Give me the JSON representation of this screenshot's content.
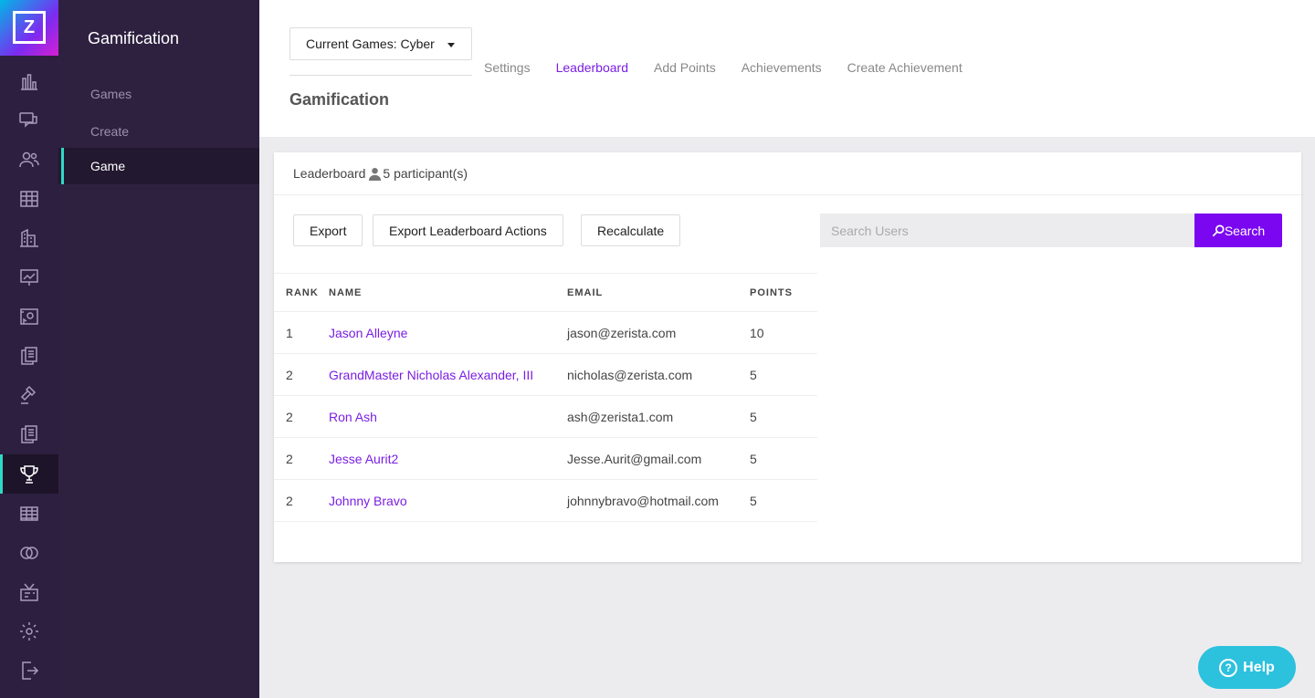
{
  "logo": {
    "letter": "Z"
  },
  "rail": {
    "icons": [
      "chart-icon",
      "chat-icon",
      "users-icon",
      "grid-icon",
      "buildings-icon",
      "presentation-icon",
      "gallery-icon",
      "documents-icon",
      "gavel-icon",
      "documents-2-icon",
      "trophy-icon",
      "table-icon",
      "rings-icon",
      "broadcast-icon",
      "gear-icon",
      "exit-icon"
    ],
    "active": "trophy-icon"
  },
  "sidebar": {
    "title": "Gamification",
    "items": [
      {
        "label": "Games"
      },
      {
        "label": "Create"
      },
      {
        "label": "Game",
        "active": true
      }
    ]
  },
  "header": {
    "game_select": "Current Games: Cyber",
    "tabs": [
      {
        "label": "Settings"
      },
      {
        "label": "Leaderboard",
        "active": true
      },
      {
        "label": "Add Points"
      },
      {
        "label": "Achievements"
      },
      {
        "label": "Create Achievement"
      }
    ],
    "page_title": "Gamification"
  },
  "leaderboard": {
    "title": "Leaderboard",
    "participants": "5 participant(s)",
    "buttons": {
      "export": "Export",
      "export_actions": "Export Leaderboard Actions",
      "recalculate": "Recalculate"
    },
    "search": {
      "placeholder": "Search Users",
      "button": "Search"
    },
    "columns": [
      "RANK",
      "NAME",
      "EMAIL",
      "POINTS"
    ],
    "rows": [
      {
        "rank": "1",
        "name": "Jason Alleyne",
        "email": "jason@zerista.com",
        "points": "10"
      },
      {
        "rank": "2",
        "name": "GrandMaster Nicholas Alexander, III",
        "email": "nicholas@zerista.com",
        "points": "5"
      },
      {
        "rank": "2",
        "name": "Ron Ash",
        "email": "ash@zerista1.com",
        "points": "5"
      },
      {
        "rank": "2",
        "name": "Jesse Aurit2",
        "email": "Jesse.Aurit@gmail.com",
        "points": "5"
      },
      {
        "rank": "2",
        "name": "Johnny Bravo",
        "email": "johnnybravo@hotmail.com",
        "points": "5"
      }
    ]
  },
  "help": {
    "label": "Help"
  },
  "colors": {
    "accent": "#7a07f0",
    "sidebar": "#2e2140",
    "rail": "#2c1f3f",
    "active_marker": "#2fd8c4",
    "help": "#2cc1dd"
  }
}
